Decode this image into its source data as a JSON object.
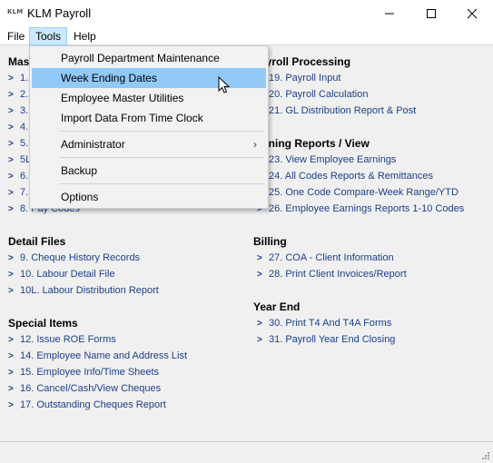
{
  "window": {
    "logo_text": "KLM",
    "title": "KLM Payroll"
  },
  "menubar": {
    "file": "File",
    "tools": "Tools",
    "help": "Help"
  },
  "tools_menu": {
    "items": [
      {
        "label": "Payroll Department Maintenance"
      },
      {
        "label": "Week Ending Dates",
        "highlighted": true
      },
      {
        "label": "Employee Master Utilities"
      },
      {
        "label": "Import Data From Time Clock"
      },
      {
        "label": "Administrator",
        "submenu": true
      },
      {
        "label": "Backup"
      },
      {
        "label": "Options"
      }
    ],
    "submenu_arrow": "›"
  },
  "sections": {
    "master": {
      "title": "Mas",
      "items": [
        "1.",
        "2.",
        "3.",
        "4.",
        "5.",
        "5L",
        "6.",
        "7.",
        "8. Pay Codes"
      ]
    },
    "payroll_processing": {
      "title": "ayroll Processing",
      "items": [
        "19. Payroll Input",
        "20. Payroll Calculation",
        "21. GL Distribution Report & Post"
      ]
    },
    "earning_reports": {
      "title": "rning Reports / View",
      "items": [
        "23. View Employee Earnings",
        "24. All Codes Reports & Remittances",
        "25. One Code Compare-Week Range/YTD",
        "26. Employee Earnings Reports 1-10 Codes"
      ]
    },
    "detail_files": {
      "title": "Detail Files",
      "items": [
        "9. Cheque History Records",
        "10. Labour Detail File",
        "10L. Labour Distribution Report"
      ]
    },
    "billing": {
      "title": "Billing",
      "items": [
        "27. COA - Client Information",
        "28. Print Client Invoices/Report"
      ]
    },
    "special_items": {
      "title": "Special Items",
      "items": [
        "12. Issue ROE Forms",
        "14. Employee Name and Address List",
        "15. Employee Info/Time Sheets",
        "16. Cancel/Cash/View Cheques",
        "17. Outstanding Cheques Report"
      ]
    },
    "year_end": {
      "title": "Year End",
      "items": [
        "30. Print T4 And T4A Forms",
        "31. Payroll Year End Closing"
      ]
    }
  },
  "colors": {
    "link": "#1d3f8a",
    "menu_highlight": "#91c9f7",
    "tools_active": "#cce8ff"
  }
}
